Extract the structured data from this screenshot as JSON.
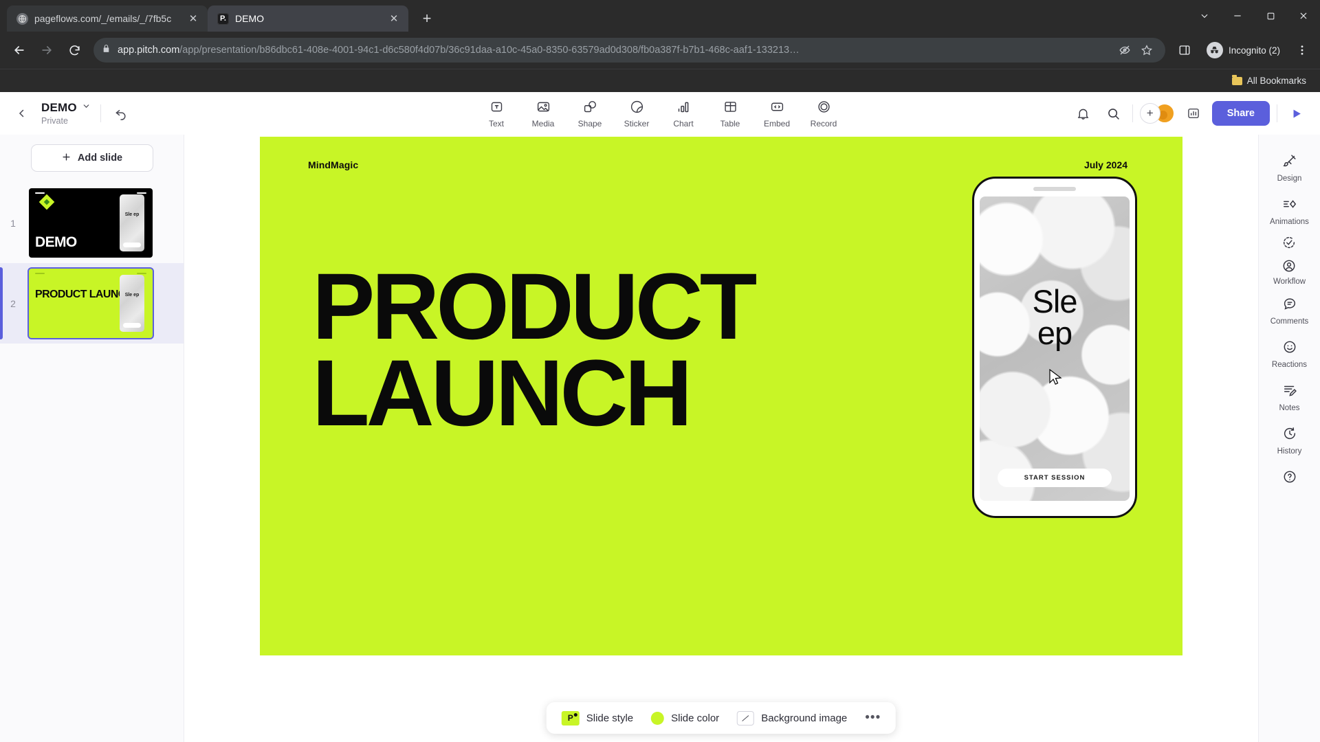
{
  "browser": {
    "tabs": [
      {
        "title": "pageflows.com/_/emails/_/7fb5c",
        "favicon": "globe-icon",
        "active": false
      },
      {
        "title": "DEMO",
        "favicon": "pitch-logo-icon",
        "active": true
      }
    ],
    "new_tab_label": "+",
    "nav": {
      "back": "←",
      "forward": "→",
      "reload": "↻"
    },
    "omnibox": {
      "lock_icon": "lock-icon",
      "url_domain": "app.pitch.com",
      "url_path": "/app/presentation/b86dbc61-408e-4001-94c1-d6c580f4d07b/36c91daa-a10c-45a0-8350-63579ad0d308/fb0a387f-b7b1-468c-aaf1-133213…"
    },
    "profile_label": "Incognito (2)",
    "bookmarks_label": "All Bookmarks",
    "window_controls": {
      "minimize": "–",
      "maximize": "☐",
      "close": "✕",
      "more_tabs": "⌄"
    }
  },
  "app": {
    "deck": {
      "name": "DEMO",
      "visibility": "Private"
    },
    "toolbar_tools": [
      {
        "label": "Text",
        "icon": "text-icon"
      },
      {
        "label": "Media",
        "icon": "media-icon"
      },
      {
        "label": "Shape",
        "icon": "shape-icon"
      },
      {
        "label": "Sticker",
        "icon": "sticker-icon"
      },
      {
        "label": "Chart",
        "icon": "chart-icon"
      },
      {
        "label": "Table",
        "icon": "table-icon"
      },
      {
        "label": "Embed",
        "icon": "embed-icon"
      },
      {
        "label": "Record",
        "icon": "record-icon"
      }
    ],
    "share_label": "Share",
    "add_slide_label": "Add slide",
    "slides": [
      {
        "number": "1",
        "title": "DEMO",
        "selected": false,
        "background": "#000000",
        "phone_word": "Sle ep"
      },
      {
        "number": "2",
        "title": "PRODUCT LAUNCH",
        "selected": true,
        "background": "#c8f526",
        "phone_word": "Sle ep"
      }
    ],
    "slide_canvas": {
      "brand": "MindMagic",
      "date": "July 2024",
      "headline_line1": "PRODUCT",
      "headline_line2": "LAUNCH",
      "background_color": "#c8f526",
      "phone": {
        "word_line1": "Sle",
        "word_line2": "ep",
        "cta_label": "START SESSION"
      }
    },
    "slide_toolbar": {
      "style_label": "Slide style",
      "style_badge": "P",
      "color_label": "Slide color",
      "color_value": "#c8f526",
      "background_label": "Background image",
      "more_label": "•••"
    },
    "right_rail": [
      {
        "label": "Design",
        "icon": "design-brush-icon"
      },
      {
        "label": "Animations",
        "icon": "animations-icon"
      },
      {
        "label": "Workflow",
        "icon": "workflow-status-icon",
        "icon2": "workflow-assignee-icon"
      },
      {
        "label": "Comments",
        "icon": "comment-bubble-icon"
      },
      {
        "label": "Reactions",
        "icon": "smiley-icon"
      },
      {
        "label": "Notes",
        "icon": "notes-pencil-icon"
      },
      {
        "label": "History",
        "icon": "history-clock-icon"
      },
      {
        "label": "",
        "icon": "help-question-icon"
      }
    ],
    "accent_color": "#5b5fdc"
  }
}
